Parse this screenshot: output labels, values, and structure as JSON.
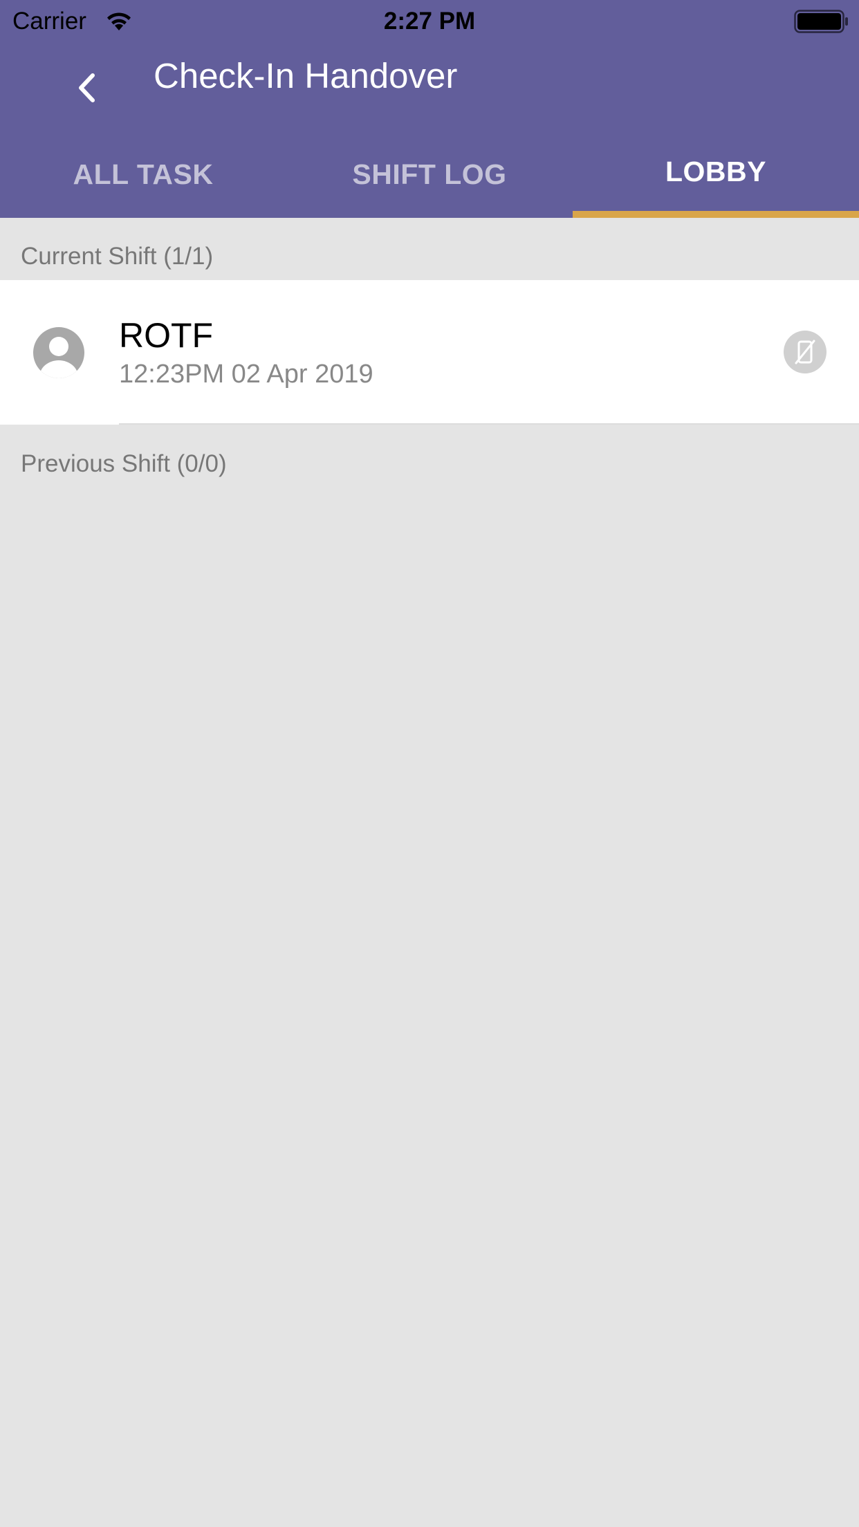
{
  "status_bar": {
    "carrier": "Carrier",
    "time": "2:27 PM"
  },
  "header": {
    "title": "Check-In Handover",
    "background_color": "#625e9b"
  },
  "tabs": [
    {
      "label": "ALL TASK",
      "active": false
    },
    {
      "label": "SHIFT LOG",
      "active": false
    },
    {
      "label": "LOBBY",
      "active": true
    }
  ],
  "accent_color": "#d9a54a",
  "current_shift": {
    "header": "Current Shift (1/1)",
    "items": [
      {
        "name": "ROTF",
        "timestamp": "12:23PM 02 Apr 2019",
        "avatar_icon": "person-avatar-icon",
        "status_icon": "no-phone-icon"
      }
    ]
  },
  "previous_shift": {
    "header": "Previous Shift (0/0)",
    "items": []
  }
}
